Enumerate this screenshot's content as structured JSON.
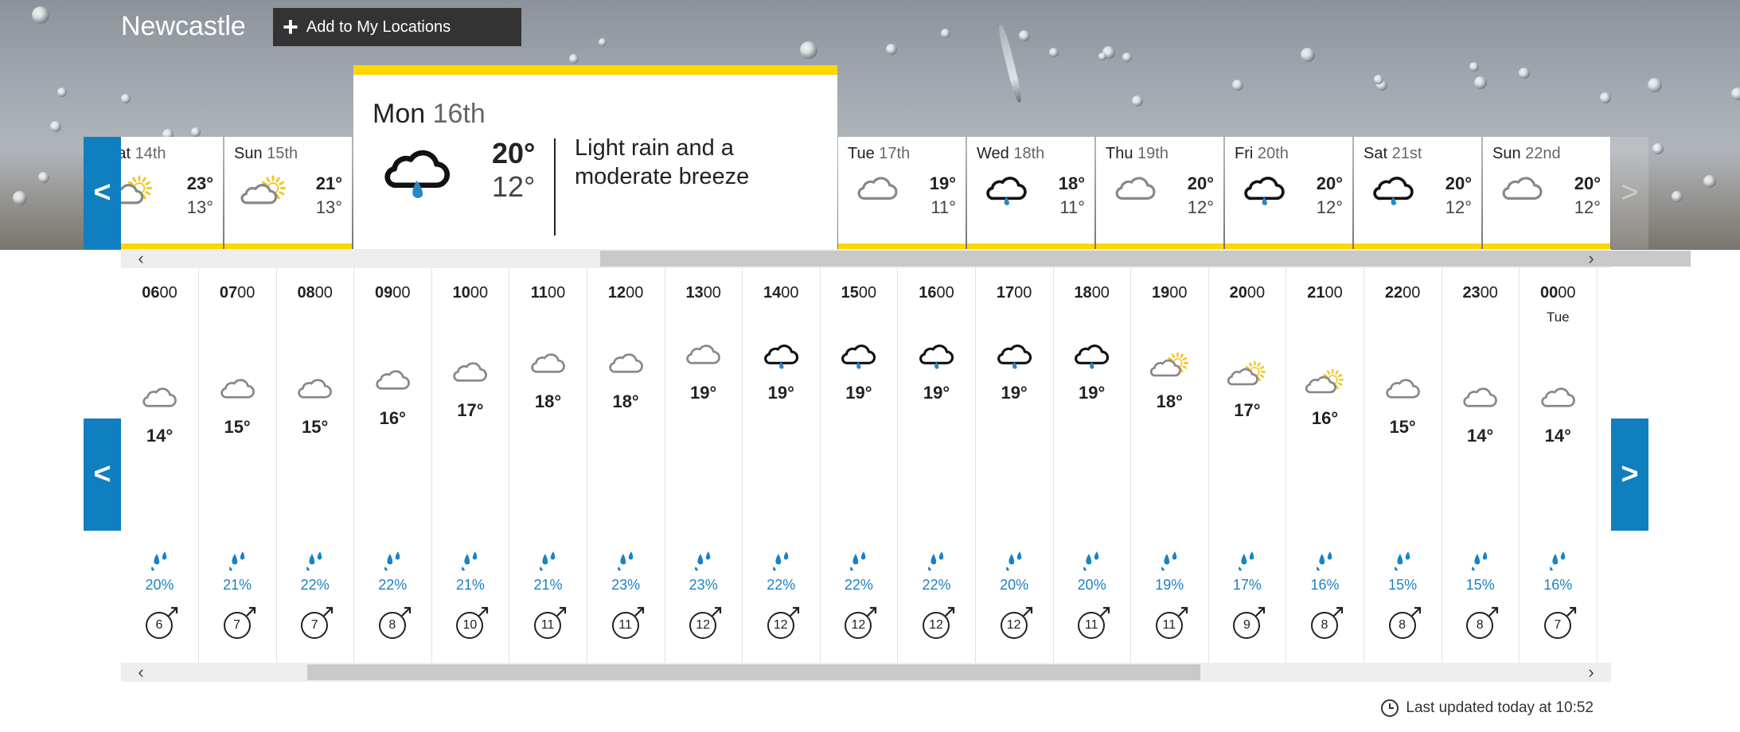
{
  "location": {
    "name": "Newcastle",
    "add_label": "Add to My Locations"
  },
  "colors": {
    "accent": "#fcd700",
    "brand_blue": "#0f7fbf",
    "rain_blue": "#1a82c4"
  },
  "days_left": [
    {
      "name": "Sat",
      "date": "14th",
      "icon": "sun-cloud-icon",
      "high": "23°",
      "low": "13°"
    },
    {
      "name": "Sun",
      "date": "15th",
      "icon": "sun-cloud-icon",
      "high": "21°",
      "low": "13°"
    }
  ],
  "selected_day": {
    "name": "Mon",
    "date": "16th",
    "icon": "heavy-rain-cloud-icon",
    "high": "20°",
    "low": "12°",
    "description": "Light rain and a moderate breeze"
  },
  "days_right": [
    {
      "name": "Tue",
      "date": "17th",
      "icon": "cloud-icon",
      "high": "19°",
      "low": "11°"
    },
    {
      "name": "Wed",
      "date": "18th",
      "icon": "rain-cloud-icon",
      "high": "18°",
      "low": "11°"
    },
    {
      "name": "Thu",
      "date": "19th",
      "icon": "cloud-icon",
      "high": "20°",
      "low": "12°"
    },
    {
      "name": "Fri",
      "date": "20th",
      "icon": "rain-cloud-icon",
      "high": "20°",
      "low": "12°"
    },
    {
      "name": "Sat",
      "date": "21st",
      "icon": "rain-cloud-icon",
      "high": "20°",
      "low": "12°"
    },
    {
      "name": "Sun",
      "date": "22nd",
      "icon": "cloud-icon",
      "high": "20°",
      "low": "12°"
    }
  ],
  "hours": [
    {
      "hh": "06",
      "mm": "00",
      "sub": "",
      "icon": "cloud-icon",
      "temp": "14°",
      "temp_value": 14,
      "rain": "20%",
      "wind": "6"
    },
    {
      "hh": "07",
      "mm": "00",
      "sub": "",
      "icon": "cloud-icon",
      "temp": "15°",
      "temp_value": 15,
      "rain": "21%",
      "wind": "7"
    },
    {
      "hh": "08",
      "mm": "00",
      "sub": "",
      "icon": "cloud-icon",
      "temp": "15°",
      "temp_value": 15,
      "rain": "22%",
      "wind": "7"
    },
    {
      "hh": "09",
      "mm": "00",
      "sub": "",
      "icon": "cloud-icon",
      "temp": "16°",
      "temp_value": 16,
      "rain": "22%",
      "wind": "8"
    },
    {
      "hh": "10",
      "mm": "00",
      "sub": "",
      "icon": "cloud-icon",
      "temp": "17°",
      "temp_value": 17,
      "rain": "21%",
      "wind": "10"
    },
    {
      "hh": "11",
      "mm": "00",
      "sub": "",
      "icon": "cloud-icon",
      "temp": "18°",
      "temp_value": 18,
      "rain": "21%",
      "wind": "11"
    },
    {
      "hh": "12",
      "mm": "00",
      "sub": "",
      "icon": "cloud-icon",
      "temp": "18°",
      "temp_value": 18,
      "rain": "23%",
      "wind": "11"
    },
    {
      "hh": "13",
      "mm": "00",
      "sub": "",
      "icon": "cloud-icon",
      "temp": "19°",
      "temp_value": 19,
      "rain": "23%",
      "wind": "12"
    },
    {
      "hh": "14",
      "mm": "00",
      "sub": "",
      "icon": "rain-cloud-icon",
      "temp": "19°",
      "temp_value": 19,
      "rain": "22%",
      "wind": "12"
    },
    {
      "hh": "15",
      "mm": "00",
      "sub": "",
      "icon": "rain-cloud-icon",
      "temp": "19°",
      "temp_value": 19,
      "rain": "22%",
      "wind": "12"
    },
    {
      "hh": "16",
      "mm": "00",
      "sub": "",
      "icon": "rain-cloud-icon",
      "temp": "19°",
      "temp_value": 19,
      "rain": "22%",
      "wind": "12"
    },
    {
      "hh": "17",
      "mm": "00",
      "sub": "",
      "icon": "rain-cloud-icon",
      "temp": "19°",
      "temp_value": 19,
      "rain": "20%",
      "wind": "12"
    },
    {
      "hh": "18",
      "mm": "00",
      "sub": "",
      "icon": "rain-cloud-icon",
      "temp": "19°",
      "temp_value": 19,
      "rain": "20%",
      "wind": "11"
    },
    {
      "hh": "19",
      "mm": "00",
      "sub": "",
      "icon": "sun-cloud-icon",
      "temp": "18°",
      "temp_value": 18,
      "rain": "19%",
      "wind": "11"
    },
    {
      "hh": "20",
      "mm": "00",
      "sub": "",
      "icon": "sun-cloud-icon",
      "temp": "17°",
      "temp_value": 17,
      "rain": "17%",
      "wind": "9"
    },
    {
      "hh": "21",
      "mm": "00",
      "sub": "",
      "icon": "sun-cloud-icon",
      "temp": "16°",
      "temp_value": 16,
      "rain": "16%",
      "wind": "8"
    },
    {
      "hh": "22",
      "mm": "00",
      "sub": "",
      "icon": "cloud-icon",
      "temp": "15°",
      "temp_value": 15,
      "rain": "15%",
      "wind": "8"
    },
    {
      "hh": "23",
      "mm": "00",
      "sub": "",
      "icon": "cloud-icon",
      "temp": "14°",
      "temp_value": 14,
      "rain": "15%",
      "wind": "8"
    },
    {
      "hh": "00",
      "mm": "00",
      "sub": "Tue",
      "icon": "cloud-icon",
      "temp": "14°",
      "temp_value": 14,
      "rain": "16%",
      "wind": "7"
    }
  ],
  "footer": {
    "updated": "Last updated today at 10:52"
  },
  "nav": {
    "prev": "<",
    "next": ">"
  }
}
